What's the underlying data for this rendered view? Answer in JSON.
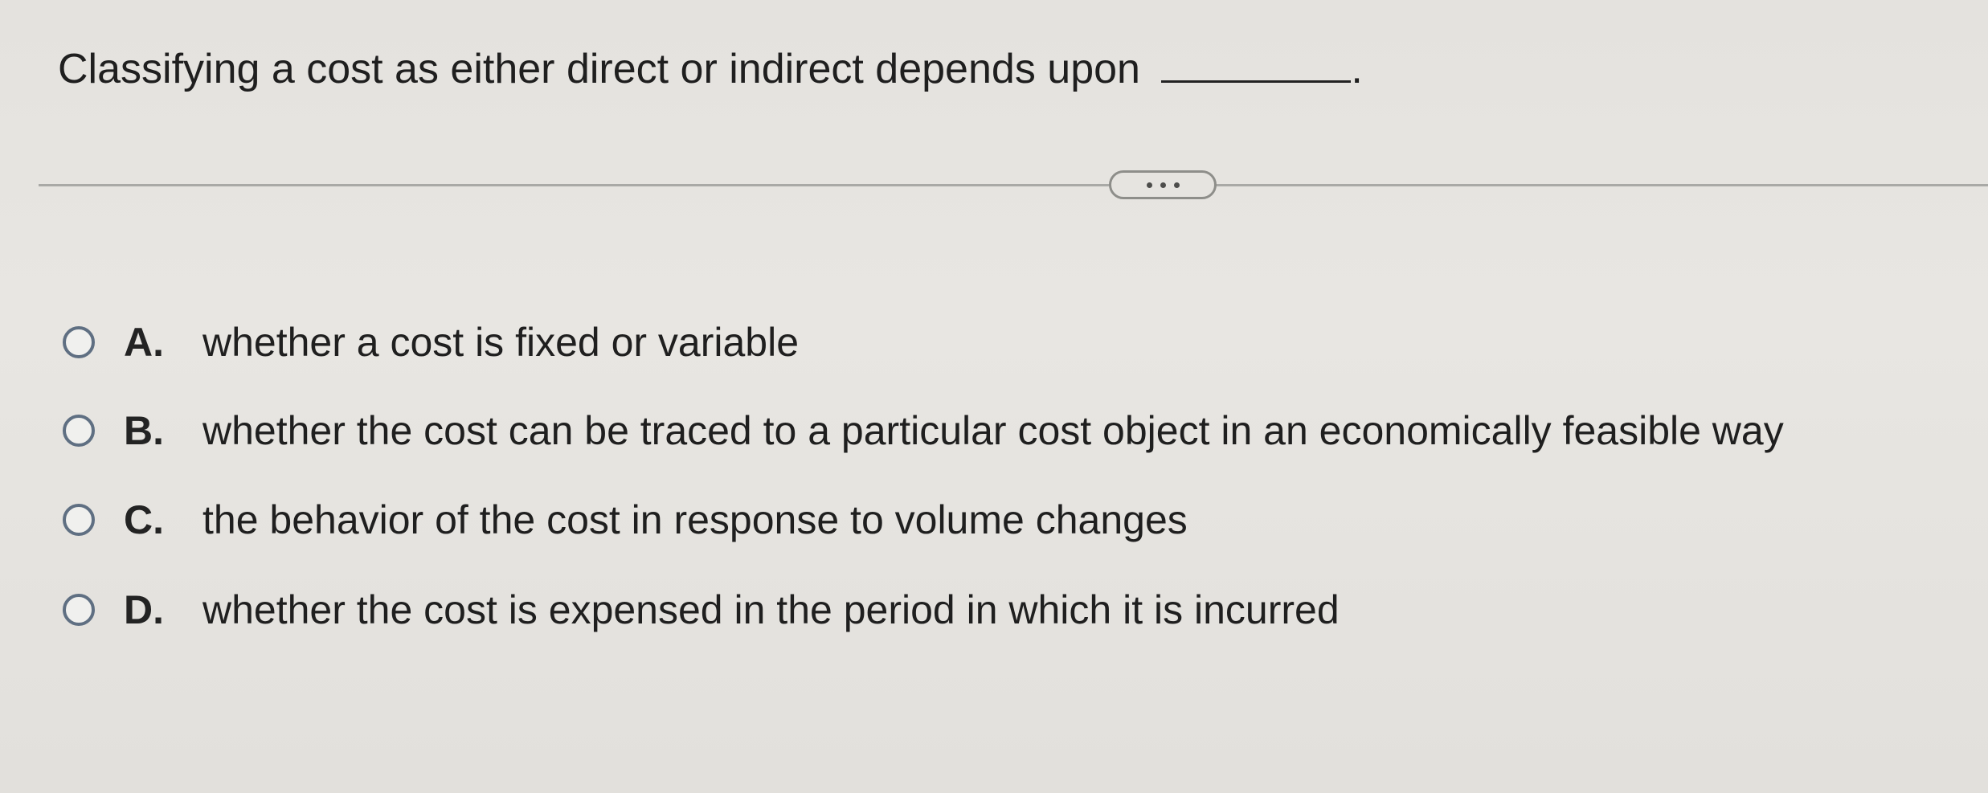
{
  "question": {
    "text": "Classifying a cost as either direct or indirect depends upon",
    "period": "."
  },
  "more_button": {
    "icon": "ellipsis-icon"
  },
  "options": [
    {
      "letter": "A.",
      "text": "whether a cost is fixed or variable"
    },
    {
      "letter": "B.",
      "text": "whether the cost can be traced to a particular cost object in an economically feasible way"
    },
    {
      "letter": "C.",
      "text": "the behavior of the cost in response to volume changes"
    },
    {
      "letter": "D.",
      "text": "whether the cost is expensed in the period in which it is incurred"
    }
  ],
  "colors": {
    "radio_border": "#5f6f82",
    "background": "#e6e4e0"
  }
}
